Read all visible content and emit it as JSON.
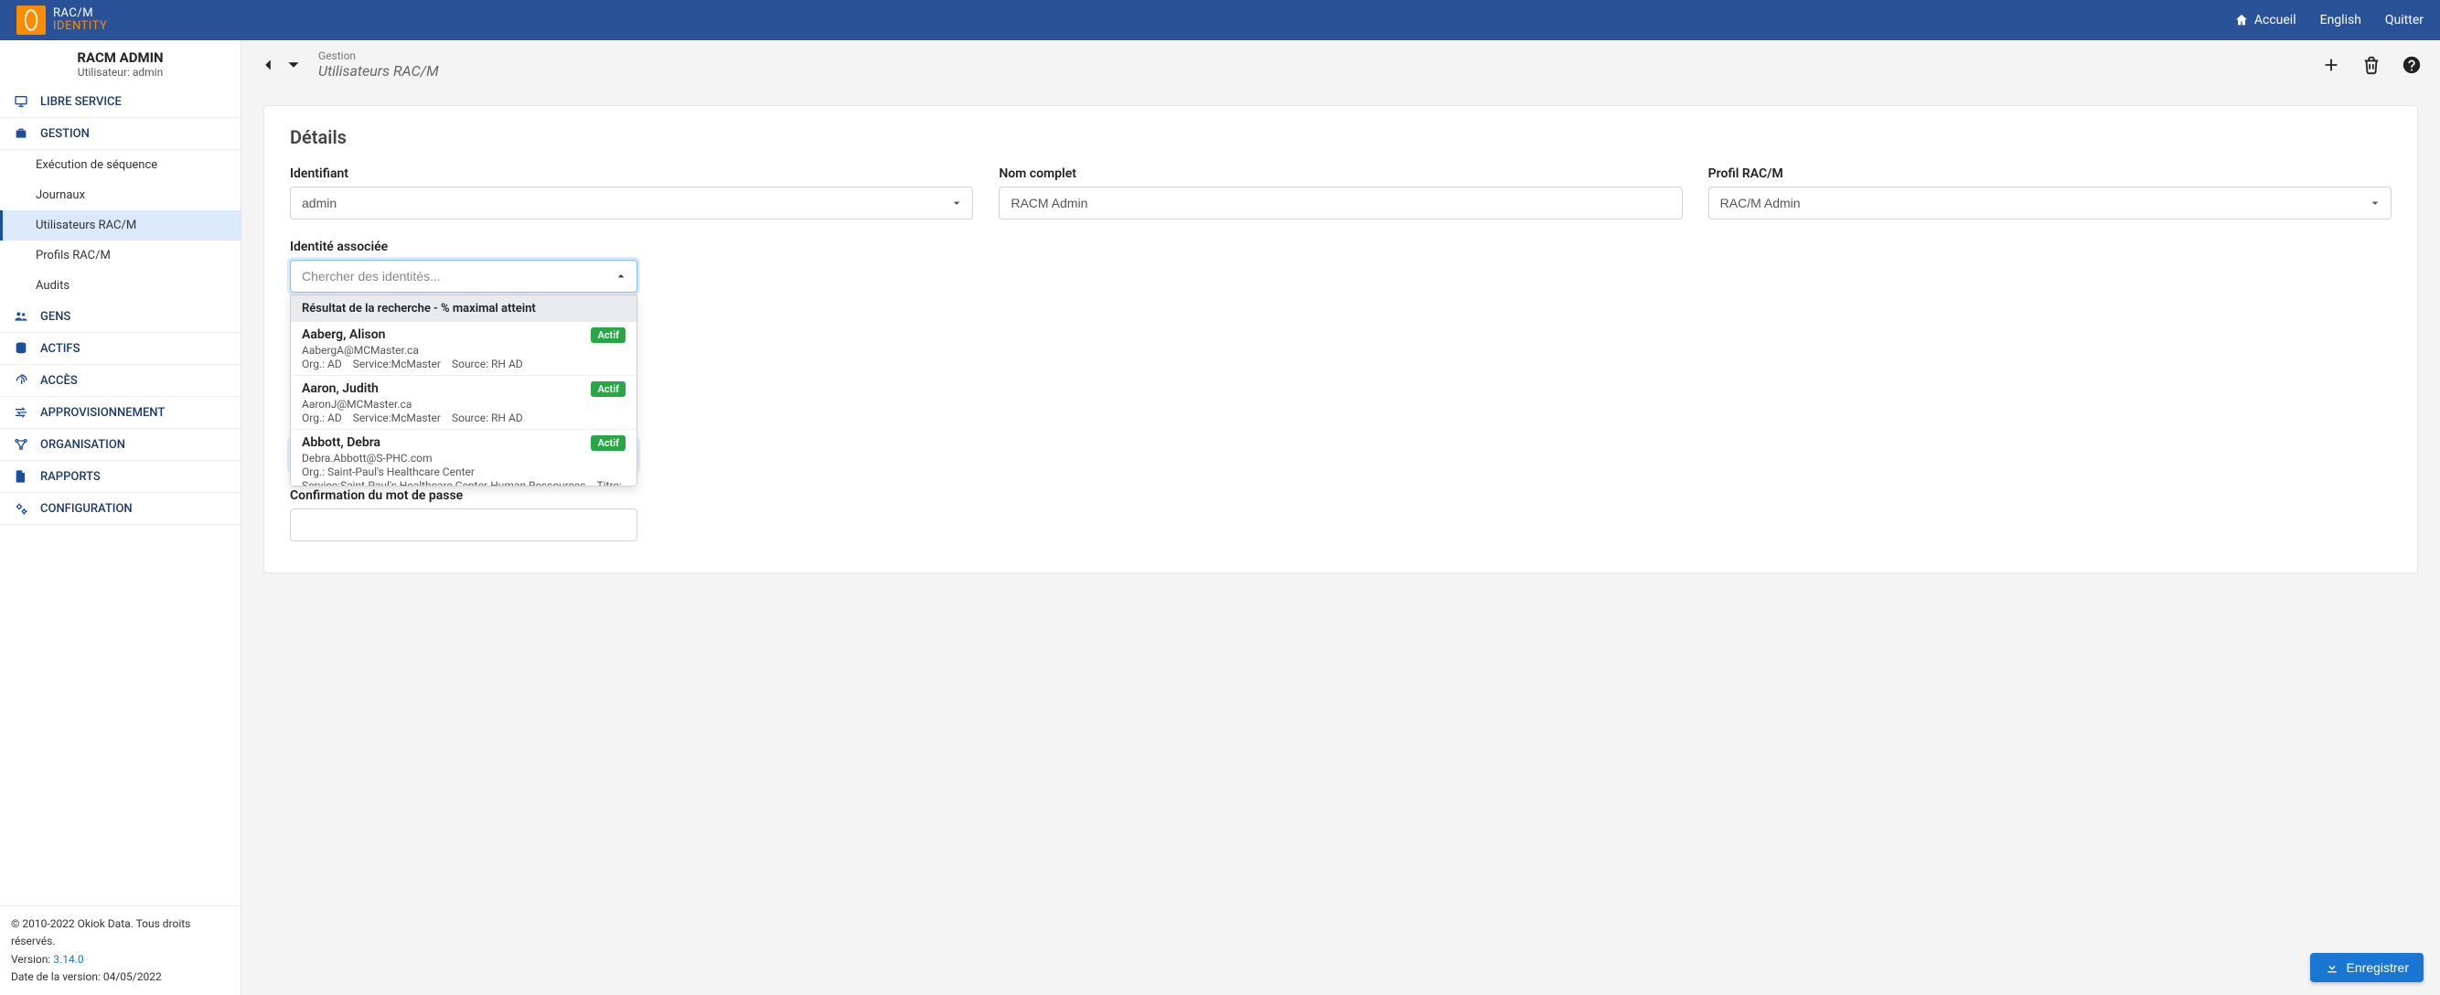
{
  "brand": {
    "line1": "RAC/M",
    "line2": "IDENTITY"
  },
  "topnav": {
    "home": "Accueil",
    "lang": "English",
    "quit": "Quitter"
  },
  "sidebar": {
    "app_name": "RACM ADMIN",
    "user_line": "Utilisateur: admin",
    "items": [
      "LIBRE SERVICE",
      "GESTION",
      "GENS",
      "ACTIFS",
      "ACCÈS",
      "APPROVISIONNEMENT",
      "ORGANISATION",
      "RAPPORTS",
      "CONFIGURATION"
    ],
    "gestion_sub": [
      "Exécution de séquence",
      "Journaux",
      "Utilisateurs RAC/M",
      "Profils RAC/M",
      "Audits"
    ]
  },
  "footer": {
    "copyright": "© 2010-2022 Okiok Data. Tous droits réservés.",
    "version_label": "Version:",
    "version": "3.14.0",
    "date_label": "Date de la version:",
    "date": "04/05/2022"
  },
  "crumb": {
    "section": "Gestion",
    "title": "Utilisateurs RAC/M"
  },
  "details": {
    "heading": "Détails",
    "identifiant_label": "Identifiant",
    "identifiant_value": "admin",
    "nom_label": "Nom complet",
    "nom_value": "RACM Admin",
    "profil_label": "Profil RAC/M",
    "profil_value": "RAC/M Admin",
    "identite_label": "Identité associée",
    "identite_placeholder": "Chercher des identités...",
    "pw_confirm_label": "Confirmation du mot de passe",
    "pw_masked": "••••••••"
  },
  "dropdown": {
    "header": "Résultat de la recherche - % maximal atteint",
    "status_label": "Actif",
    "items": [
      {
        "name": "Aaberg, Alison",
        "email": "AabergA@MCMaster.ca",
        "meta": [
          "Org.: AD",
          "Service:McMaster",
          "Source: RH AD"
        ]
      },
      {
        "name": "Aaron, Judith",
        "email": "AaronJ@MCMaster.ca",
        "meta": [
          "Org.: AD",
          "Service:McMaster",
          "Source: RH AD"
        ]
      },
      {
        "name": "Abbott, Debra",
        "email": "Debra.Abbott@S-PHC.com",
        "meta": [
          "Org.: Saint-Paul's Healthcare Center"
        ],
        "meta2": [
          "Service:Saint-Paul's Healthcare Center-Human Ressources",
          "Titre: Administrator"
        ]
      }
    ]
  },
  "save_label": "Enregistrer"
}
